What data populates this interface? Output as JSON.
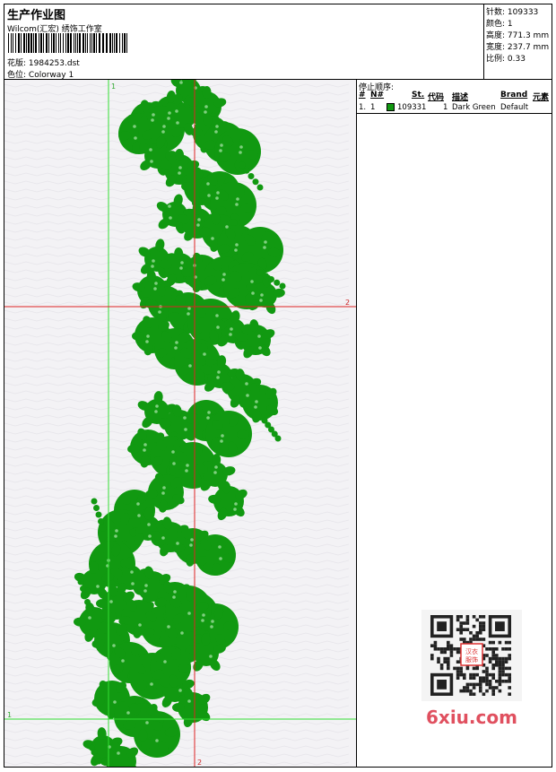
{
  "header": {
    "title": "生产作业图",
    "company": "Wilcom(汇宏) 绣饰工作室",
    "design_label": "花版:",
    "design_value": "1984253.dst",
    "colorway_label": "色位:",
    "colorway_value": "Colorway 1"
  },
  "stats": {
    "stitches_label": "针数:",
    "stitches_value": "109333",
    "colors_label": "颜色:",
    "colors_value": "1",
    "height_label": "高度:",
    "height_value": "771.3 mm",
    "width_label": "宽度:",
    "width_value": "237.7 mm",
    "scale_label": "比例:",
    "scale_value": "0.33"
  },
  "canvas": {
    "marker_top_v1": "1",
    "marker_right_h2": "2",
    "marker_left_h1": "1",
    "marker_bottom_v2": "2",
    "guide_green": "#33dd33",
    "guide_red": "#dd2222",
    "embroidery_color": "#119911"
  },
  "stop_sequence": {
    "title": "停止顺序:",
    "headers": {
      "hash": "#",
      "needle": "N#",
      "stitches": "St.",
      "code": "代码",
      "description": "描述",
      "brand": "Brand",
      "element": "元素"
    },
    "rows": [
      {
        "index": "1.",
        "needle": "1",
        "color": "#119911",
        "stitches": "109331",
        "code": "1",
        "description": "Dark Green",
        "brand": "Default"
      }
    ]
  },
  "watermark": {
    "qr_seal": "汉衣服饰",
    "site": "6xiu.com"
  }
}
